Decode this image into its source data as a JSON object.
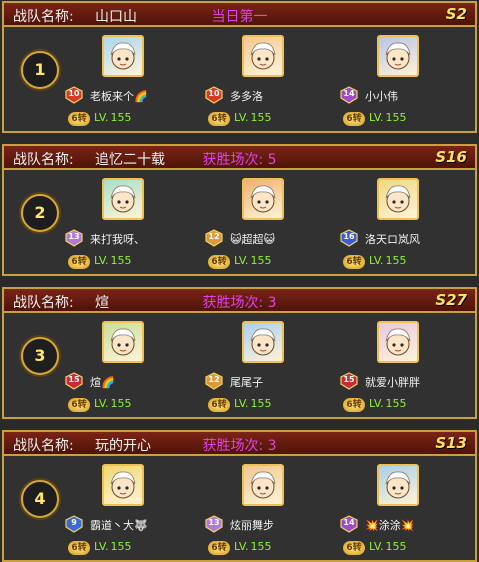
{
  "label": "战队名称:",
  "level_prefix": "LV.",
  "teams": [
    {
      "rank": "1",
      "name": "山口山",
      "status": "当日第一",
      "server": "S2",
      "members": [
        {
          "name": "老板来个🌈",
          "badge": "10",
          "chip": "6转",
          "level": "155",
          "badge_color": "#d43a2a",
          "bg": "#a8d8f0"
        },
        {
          "name": "多多洛",
          "badge": "10",
          "chip": "6转",
          "level": "155",
          "badge_color": "#d43a2a",
          "bg": "#f4c890"
        },
        {
          "name": "小小伟",
          "badge": "14",
          "chip": "6转",
          "level": "155",
          "badge_color": "#a04ac8",
          "bg": "#b8c4e8"
        }
      ]
    },
    {
      "rank": "2",
      "name": "追忆二十载",
      "status": "获胜场次: 5",
      "server": "S16",
      "members": [
        {
          "name": "来打我呀、",
          "badge": "13",
          "chip": "6转",
          "level": "155",
          "badge_color": "#b07ad8",
          "bg": "#a8e0c8"
        },
        {
          "name": "😺超超😺",
          "badge": "12",
          "chip": "6转",
          "level": "155",
          "badge_color": "#d89a3a",
          "bg": "#f0b070"
        },
        {
          "name": "洛天ロ岚风",
          "badge": "16",
          "chip": "6转",
          "level": "155",
          "badge_color": "#3a5ad8",
          "bg": "#f0d880"
        }
      ]
    },
    {
      "rank": "3",
      "name": "煊",
      "status": "获胜场次: 3",
      "server": "S27",
      "members": [
        {
          "name": "煊🌈",
          "badge": "15",
          "chip": "6转",
          "level": "155",
          "badge_color": "#c82a3a",
          "bg": "#c8e098"
        },
        {
          "name": "尾尾子",
          "badge": "12",
          "chip": "6转",
          "level": "155",
          "badge_color": "#d89a3a",
          "bg": "#a8d0f0"
        },
        {
          "name": "就爱小胖胖",
          "badge": "15",
          "chip": "6转",
          "level": "155",
          "badge_color": "#c82a3a",
          "bg": "#e8c8e0"
        }
      ]
    },
    {
      "rank": "4",
      "name": "玩的开心",
      "status": "获胜场次: 3",
      "server": "S13",
      "members": [
        {
          "name": "霸道丶大🐺",
          "badge": "9",
          "chip": "6转",
          "level": "155",
          "badge_color": "#3a6ad8",
          "bg": "#f0d870"
        },
        {
          "name": "炫丽舞步",
          "badge": "13",
          "chip": "6转",
          "level": "155",
          "badge_color": "#b07ad8",
          "bg": "#f0c890"
        },
        {
          "name": "💥涂涂💥",
          "badge": "14",
          "chip": "6转",
          "level": "155",
          "badge_color": "#a04ac8",
          "bg": "#a8d0e8"
        }
      ]
    }
  ]
}
